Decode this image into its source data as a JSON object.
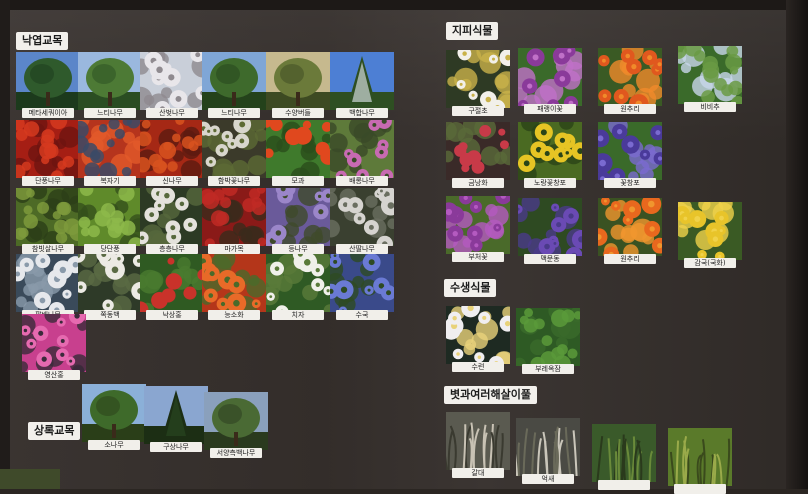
{
  "sections": {
    "deciduous": "낙엽교목",
    "evergreen": "상록교목",
    "groundcover": "지피식물",
    "aquatic": "수생식물",
    "grasses": "볏과여러해살이풀"
  },
  "tiles": [
    {
      "caption": "메타세쿼이아",
      "palette": [
        "#5b86c9",
        "#2f5a2c",
        "#1c3a1c"
      ],
      "kind": "tree"
    },
    {
      "caption": "느티나무",
      "palette": [
        "#9ab8de",
        "#4d7a35",
        "#2a4d22"
      ],
      "kind": "tree"
    },
    {
      "caption": "산벚나무",
      "palette": [
        "#c9cfd9",
        "#e8e6ea",
        "#8f8a8f"
      ],
      "kind": "blossom"
    },
    {
      "caption": "느티나무",
      "palette": [
        "#7fa6d6",
        "#3e6a2c",
        "#24421b"
      ],
      "kind": "tree"
    },
    {
      "caption": "수양버들",
      "palette": [
        "#c6b98e",
        "#6b7a3a",
        "#3d4a22"
      ],
      "kind": "tree"
    },
    {
      "caption": "백합나무",
      "palette": [
        "#4d7fd4",
        "#e9eef6",
        "#2e4f22"
      ],
      "kind": "tall"
    },
    {
      "caption": "단풍나무",
      "palette": [
        "#a51e14",
        "#d63a1e",
        "#6e1410"
      ],
      "kind": "leaves"
    },
    {
      "caption": "복자기",
      "palette": [
        "#b5341d",
        "#3b4a66",
        "#e25a2a"
      ],
      "kind": "leaves"
    },
    {
      "caption": "신나무",
      "palette": [
        "#a52815",
        "#d8521f",
        "#5c1a10"
      ],
      "kind": "leaves"
    },
    {
      "caption": "함박꽃나무",
      "palette": [
        "#3b3a2a",
        "#d8d6cc",
        "#5d6a34"
      ],
      "kind": "blossom"
    },
    {
      "caption": "모과",
      "palette": [
        "#3f7a2c",
        "#e0481e",
        "#2a4d1c"
      ],
      "kind": "fruit"
    },
    {
      "caption": "배롱나무",
      "palette": [
        "#5e7a3a",
        "#c86ab2",
        "#3a4a28"
      ],
      "kind": "flower"
    },
    {
      "caption": "참빗살나무",
      "palette": [
        "#4d6a26",
        "#7e9a3c",
        "#2c3f18"
      ],
      "kind": "leaves"
    },
    {
      "caption": "당단풍",
      "palette": [
        "#5f8a2a",
        "#8db84a",
        "#35501c"
      ],
      "kind": "leaves"
    },
    {
      "caption": "층층나무",
      "palette": [
        "#2c3a24",
        "#e4e2dc",
        "#56683c"
      ],
      "kind": "blossom"
    },
    {
      "caption": "마가목",
      "palette": [
        "#8a1a18",
        "#c02a24",
        "#3a2a1c"
      ],
      "kind": "leaves"
    },
    {
      "caption": "등나무",
      "palette": [
        "#6a5a9a",
        "#9b86c9",
        "#3e4a2a"
      ],
      "kind": "flower"
    },
    {
      "caption": "산딸나무",
      "palette": [
        "#3a4030",
        "#d6d4d0",
        "#6a6e60"
      ],
      "kind": "blossom"
    },
    {
      "caption": "팥배나무",
      "palette": [
        "#3a4a5a",
        "#e6e8ec",
        "#8a9aaa"
      ],
      "kind": "blossom"
    },
    {
      "caption": "쪽동백",
      "palette": [
        "#2e3a28",
        "#eceae4",
        "#5a6a44"
      ],
      "kind": "blossom"
    },
    {
      "caption": "낙상홍",
      "palette": [
        "#2f5a22",
        "#c9322a",
        "#4a7a30"
      ],
      "kind": "fruit"
    },
    {
      "caption": "능소화",
      "palette": [
        "#b4361a",
        "#e86a28",
        "#4a6a2a"
      ],
      "kind": "flower"
    },
    {
      "caption": "치자",
      "palette": [
        "#2f5a24",
        "#f0f0ea",
        "#5a7a3a"
      ],
      "kind": "flower"
    },
    {
      "caption": "수국",
      "palette": [
        "#3a4a8a",
        "#6a7ad4",
        "#2e4a22"
      ],
      "kind": "flower"
    },
    {
      "caption": "영산홍",
      "palette": [
        "#c8408e",
        "#e66ab0",
        "#3a2a3a"
      ],
      "kind": "flower"
    },
    {
      "caption": "소나무",
      "palette": [
        "#8bb0d8",
        "#3e6a2a",
        "#2a3e18"
      ],
      "kind": "tree"
    },
    {
      "caption": "구상나무",
      "palette": [
        "#8aa6d0",
        "#2a4a22",
        "#1c2e14"
      ],
      "kind": "tall"
    },
    {
      "caption": "서양측백나무",
      "palette": [
        "#8aa0bc",
        "#4a6a34",
        "#2a3a1e"
      ],
      "kind": "tree"
    },
    {
      "caption": "구절초",
      "palette": [
        "#2e3a24",
        "#f2f0ea",
        "#c9b24a"
      ],
      "kind": "flower"
    },
    {
      "caption": "패랭이꽃",
      "palette": [
        "#3a6a2a",
        "#8a3a9a",
        "#c070c8"
      ],
      "kind": "flower"
    },
    {
      "caption": "원추리",
      "palette": [
        "#3a5a24",
        "#e0581e",
        "#f08a2a"
      ],
      "kind": "flower"
    },
    {
      "caption": "비비추",
      "palette": [
        "#3a6a2a",
        "#6a9a44",
        "#c8d6ea"
      ],
      "kind": "leaves"
    },
    {
      "caption": "금낭화",
      "palette": [
        "#3a2a28",
        "#c83a48",
        "#5a6a3a"
      ],
      "kind": "fruit"
    },
    {
      "caption": "노랑꽃창포",
      "palette": [
        "#4a6a22",
        "#e6c424",
        "#2a4418"
      ],
      "kind": "flower"
    },
    {
      "caption": "꽃창포",
      "palette": [
        "#3a6a2a",
        "#4a3a9a",
        "#7a6ad0"
      ],
      "kind": "flower"
    },
    {
      "caption": "부처꽃",
      "palette": [
        "#4a6a2a",
        "#8a3a9a",
        "#b45ac0"
      ],
      "kind": "flower"
    },
    {
      "caption": "맥문동",
      "palette": [
        "#2e4a22",
        "#6a4ab4",
        "#4a3a8a"
      ],
      "kind": "flower"
    },
    {
      "caption": "원추리",
      "palette": [
        "#3a5222",
        "#e8681e",
        "#f0962e"
      ],
      "kind": "flower"
    },
    {
      "caption": "감국(국화)",
      "palette": [
        "#3a5a24",
        "#e8c42a",
        "#f0d24a"
      ],
      "kind": "flower"
    },
    {
      "caption": "수련",
      "palette": [
        "#1e2a22",
        "#f0eef0",
        "#e8d27a"
      ],
      "kind": "flower"
    },
    {
      "caption": "부레옥잠",
      "palette": [
        "#2e5a24",
        "#5a9a3a",
        "#3a6a2a"
      ],
      "kind": "leaves"
    },
    {
      "caption": "갈대",
      "palette": [
        "#5a5a50",
        "#c8c2b4",
        "#3a3a30"
      ],
      "kind": "grass"
    },
    {
      "caption": "억새",
      "palette": [
        "#4a4a44",
        "#cac6ba",
        "#6a6a5a"
      ],
      "kind": "grass"
    },
    {
      "caption": "",
      "palette": [
        "#3a5a2a",
        "#6a8a3a",
        "#2a3a1c"
      ],
      "kind": "grass"
    },
    {
      "caption": "",
      "palette": [
        "#5a7a2a",
        "#9aaa4a",
        "#3a4a1c"
      ],
      "kind": "grass"
    }
  ]
}
